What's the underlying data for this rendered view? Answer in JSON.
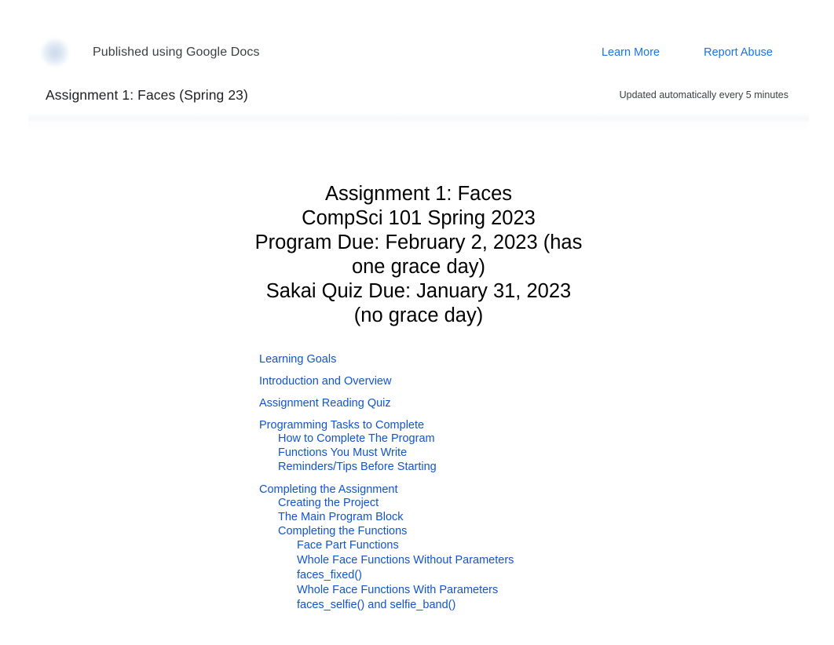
{
  "published_bar": {
    "logo_icon": "google-docs-logo-icon",
    "title": "Published using Google Docs",
    "links": [
      {
        "name": "learn-more",
        "label": "Learn More"
      },
      {
        "name": "report-abuse",
        "label": "Report Abuse"
      }
    ],
    "link_color": "#1a73e8"
  },
  "doc_bar": {
    "title": "Assignment 1: Faces (Spring 23)",
    "updated": "Updated automatically every 5 minutes"
  },
  "document": {
    "title_lines": [
      "Assignment 1: Faces",
      "CompSci 101 Spring 2023",
      "Program Due: February 2, 2023 (has",
      "one grace day)",
      "Sakai Quiz Due: January 31, 2023",
      "(no grace day)"
    ],
    "toc_link_color": "#1155cc",
    "toc": [
      {
        "label": "Learning Goals",
        "level": 1
      },
      {
        "label": "Introduction and Overview",
        "level": 1
      },
      {
        "label": "Assignment Reading Quiz",
        "level": 1
      },
      {
        "label": "Programming Tasks to Complete",
        "level": 1
      },
      {
        "label": "How to Complete The Program",
        "level": 2
      },
      {
        "label": "Functions You Must Write",
        "level": 2
      },
      {
        "label": "Reminders/Tips Before Starting",
        "level": 2
      },
      {
        "label": "Completing the Assignment",
        "level": 1
      },
      {
        "label": "Creating the Project",
        "level": 2
      },
      {
        "label": "The Main Program Block",
        "level": 2
      },
      {
        "label": "Completing the Functions",
        "level": 2
      },
      {
        "label": "Face  Part Functions",
        "level": 3
      },
      {
        "label": "Whole Face Functions Without Parameters",
        "level": 3
      },
      {
        "label": "faces_fixed()",
        "level": 3
      },
      {
        "label": "Whole Face Functions With Parameters",
        "level": 3
      },
      {
        "label": "faces_selfie() and selfie_band()",
        "level": 3
      }
    ]
  }
}
